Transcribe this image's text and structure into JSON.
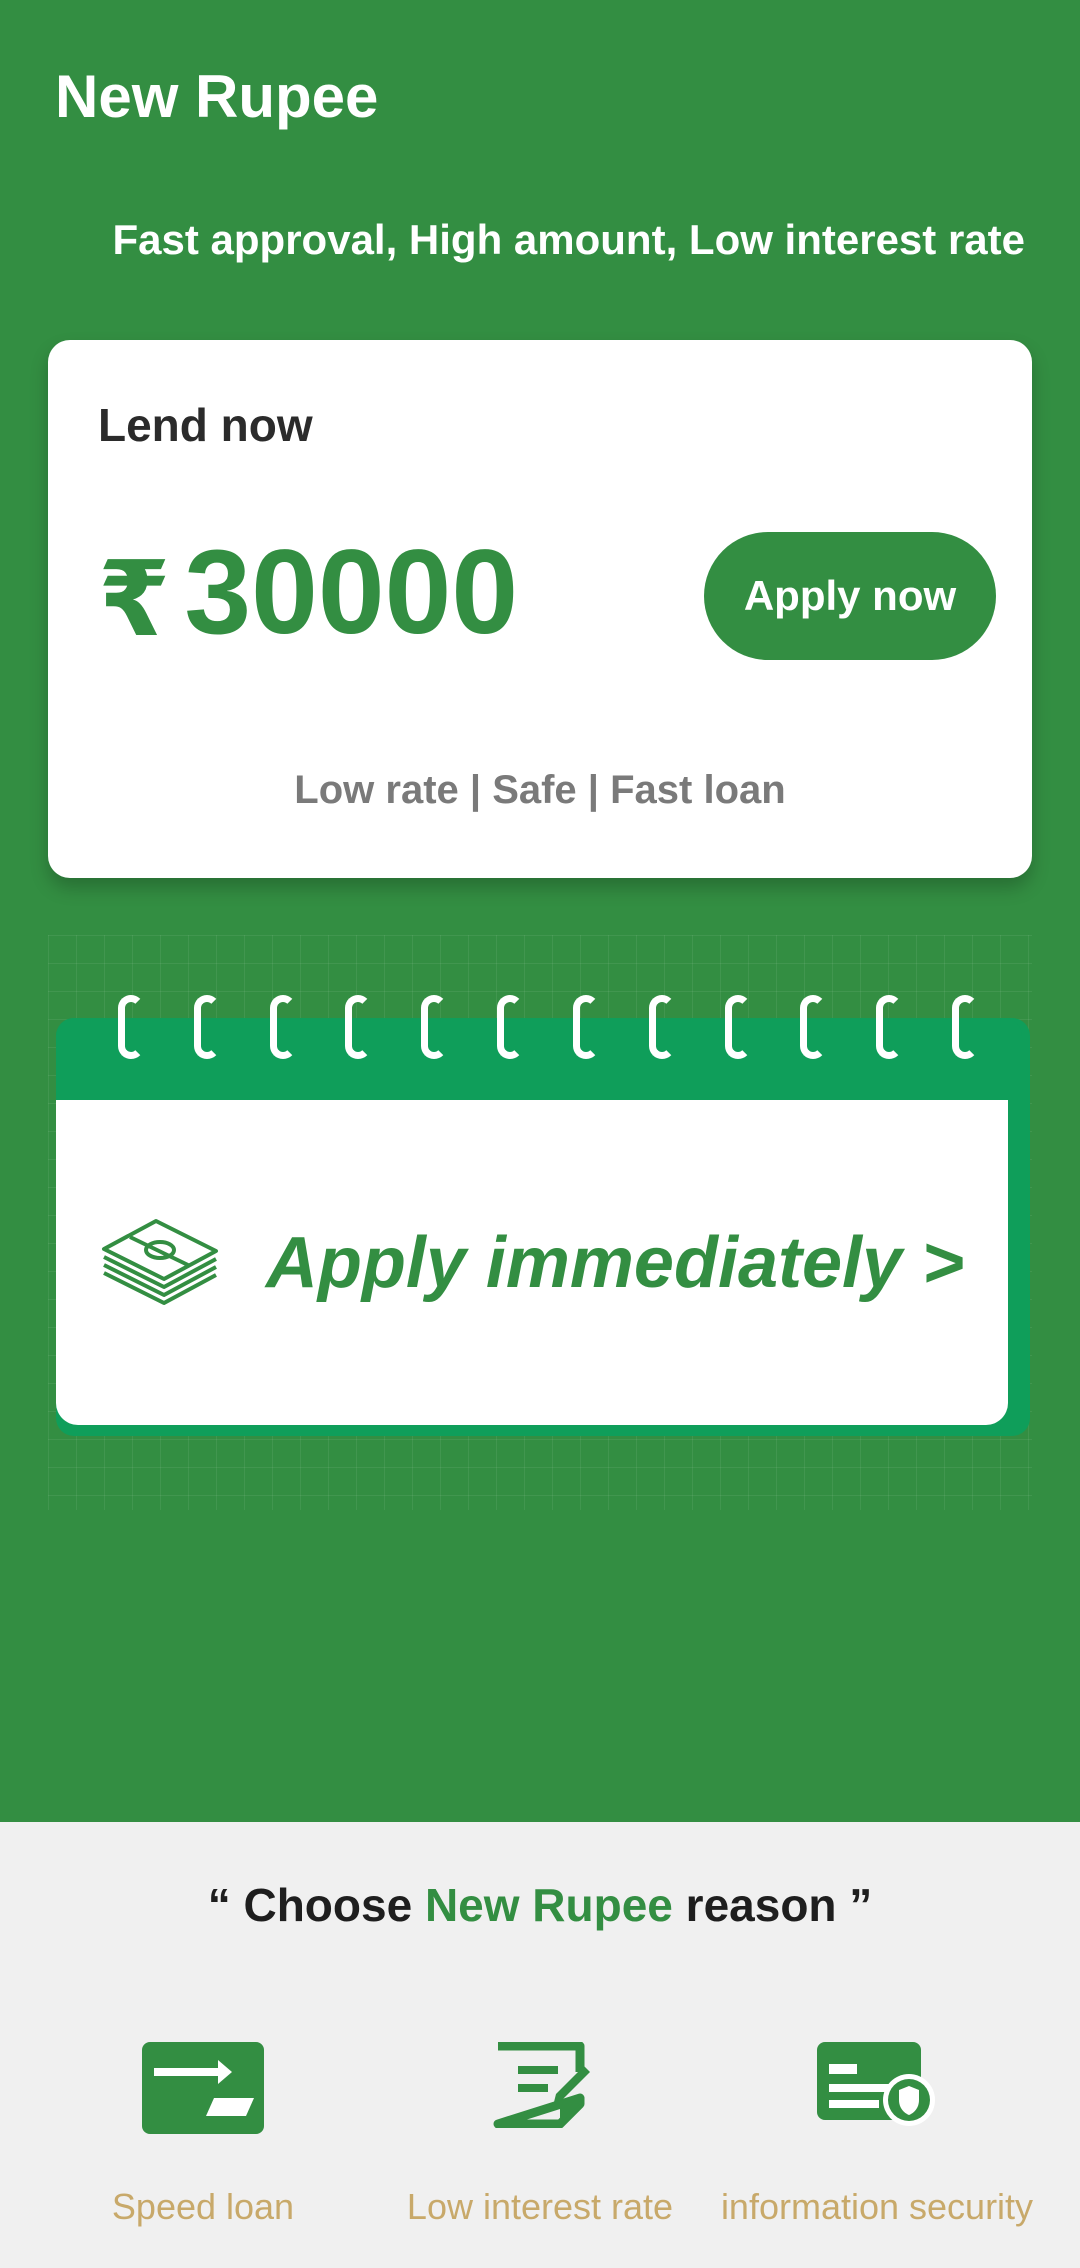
{
  "header": {
    "app_title": "New Rupee",
    "tagline": "Fast approval, High amount, Low interest rate"
  },
  "loan_card": {
    "title": "Lend now",
    "currency_symbol": "₹",
    "amount": "30000",
    "apply_button": "Apply now",
    "features": "Low rate | Safe | Fast loan"
  },
  "banner": {
    "text": "Apply immediately >",
    "icon": "money-stack-icon"
  },
  "reasons": {
    "prefix": "“ Choose ",
    "brand": "New Rupee",
    "suffix": " reason ”",
    "items": [
      {
        "label": "Speed loan",
        "icon": "card-transfer-icon"
      },
      {
        "label": "Low interest rate",
        "icon": "edit-document-icon"
      },
      {
        "label": "information security",
        "icon": "id-shield-icon"
      }
    ]
  },
  "colors": {
    "primary": "#338e42",
    "calendar": "#0f9e5a",
    "feature_label": "#c8a96a",
    "muted_text": "#7a7a7a",
    "bottom_bg": "#f0f0f0"
  }
}
